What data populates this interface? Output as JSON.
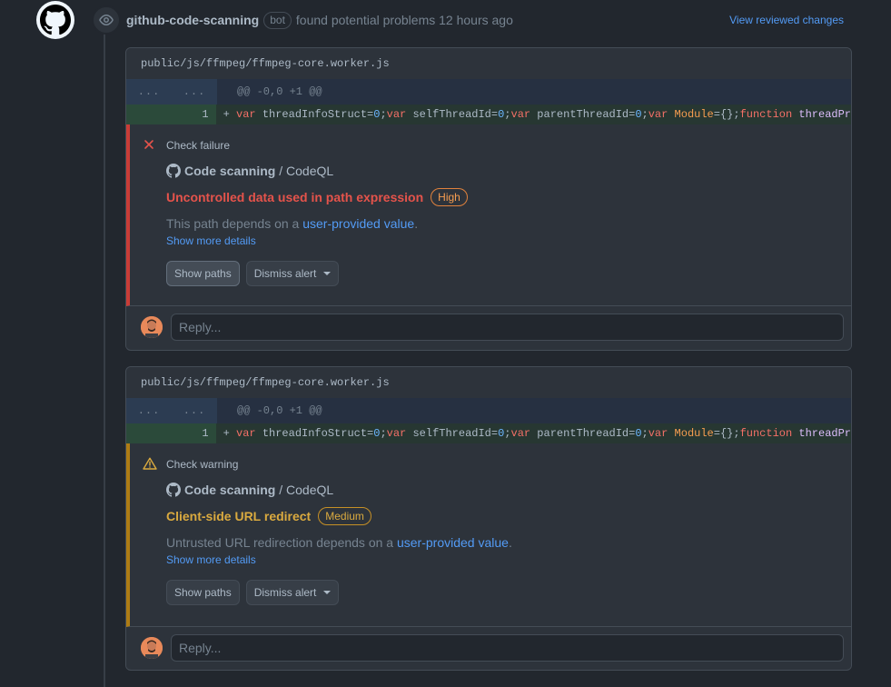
{
  "header": {
    "author": "github-code-scanning",
    "bot_label": "bot",
    "action_text": "found potential problems 12 hours ago",
    "view_link": "View reviewed changes"
  },
  "comments": [
    {
      "file_path": "public/js/ffmpeg/ffmpeg-core.worker.js",
      "expand_left": "...",
      "expand_right": "...",
      "hunk": "@@ -0,0 +1 @@",
      "line_number": "1",
      "code_prefix": "+",
      "code_tokens": [
        {
          "t": "var",
          "c": "kw"
        },
        {
          "t": " threadInfoStruct=",
          "c": ""
        },
        {
          "t": "0",
          "c": "num"
        },
        {
          "t": ";",
          "c": ""
        },
        {
          "t": "var",
          "c": "kw"
        },
        {
          "t": " selfThreadId=",
          "c": ""
        },
        {
          "t": "0",
          "c": "num"
        },
        {
          "t": ";",
          "c": ""
        },
        {
          "t": "var",
          "c": "kw"
        },
        {
          "t": " parentThreadId=",
          "c": ""
        },
        {
          "t": "0",
          "c": "num"
        },
        {
          "t": ";",
          "c": ""
        },
        {
          "t": "var",
          "c": "kw"
        },
        {
          "t": " ",
          "c": ""
        },
        {
          "t": "Module",
          "c": "cls"
        },
        {
          "t": "={};",
          "c": ""
        },
        {
          "t": "function",
          "c": "kw"
        },
        {
          "t": " threadPr",
          "c": "fn"
        }
      ],
      "status": "Check failure",
      "status_icon": "x-icon",
      "tool_name": "Code scanning",
      "tool_suffix": " / CodeQL",
      "rule_title": "Uncontrolled data used in path expression",
      "severity": "High",
      "description_prefix": "This path depends on a ",
      "description_link": "user-provided value",
      "description_suffix": ".",
      "more_link": "Show more details",
      "show_paths": "Show paths",
      "dismiss": "Dismiss alert",
      "reply_placeholder": "Reply..."
    },
    {
      "file_path": "public/js/ffmpeg/ffmpeg-core.worker.js",
      "expand_left": "...",
      "expand_right": "...",
      "hunk": "@@ -0,0 +1 @@",
      "line_number": "1",
      "code_prefix": "+",
      "status": "Check warning",
      "status_icon": "alert-triangle-icon",
      "tool_name": "Code scanning",
      "tool_suffix": " / CodeQL",
      "rule_title": "Client-side URL redirect",
      "severity": "Medium",
      "description_prefix": "Untrusted URL redirection depends on a ",
      "description_link": "user-provided value",
      "description_suffix": ".",
      "more_link": "Show more details",
      "show_paths": "Show paths",
      "dismiss": "Dismiss alert",
      "reply_placeholder": "Reply..."
    }
  ],
  "colors": {
    "background": "#22272e",
    "failure": "#e5534b",
    "warning": "#daaa3f",
    "link": "#539bf5"
  }
}
